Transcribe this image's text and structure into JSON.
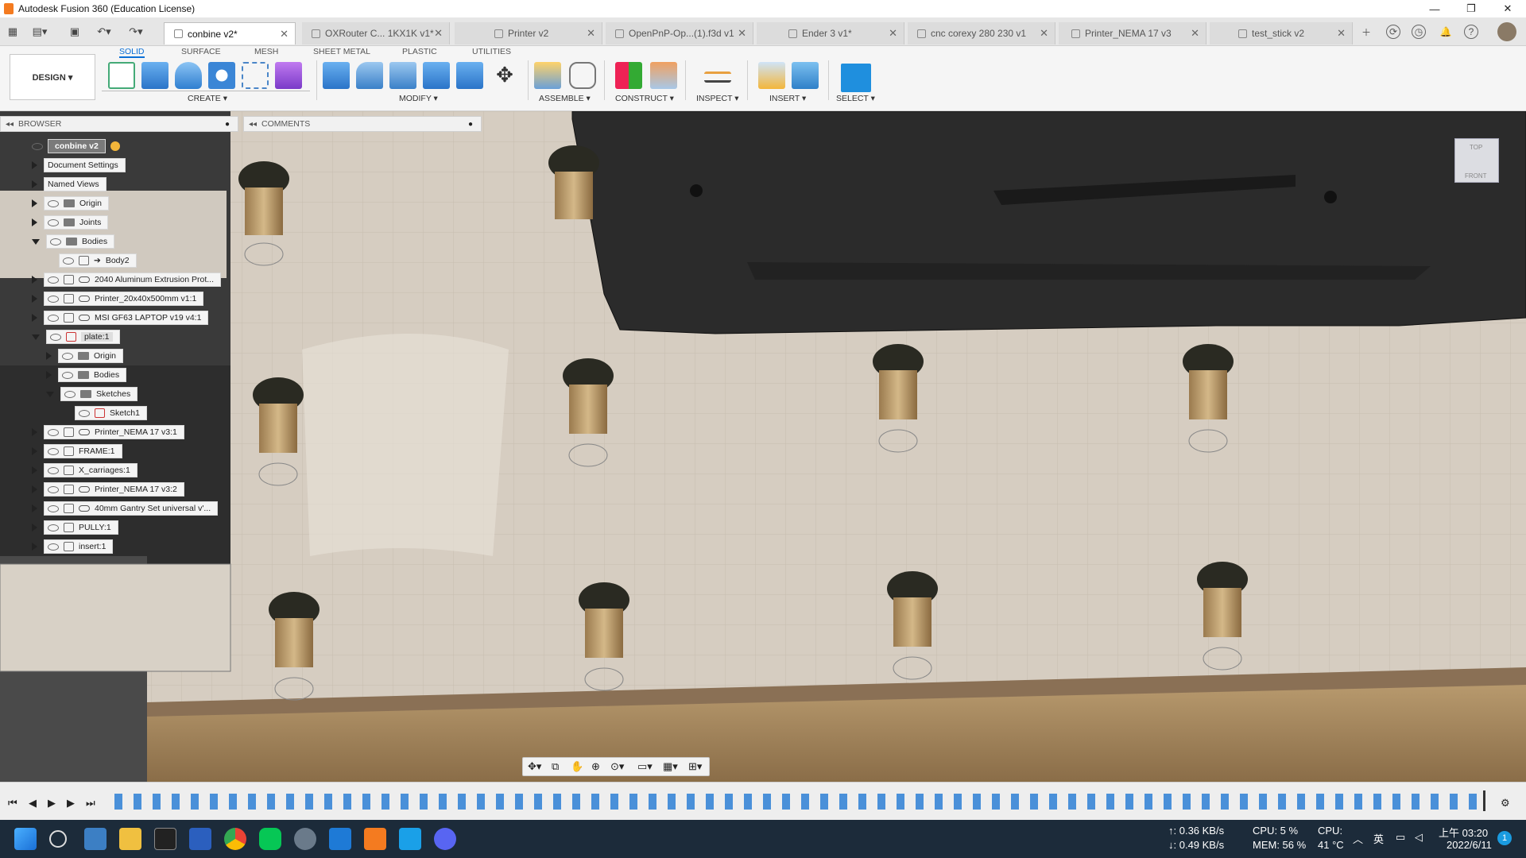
{
  "window": {
    "title": "Autodesk Fusion 360 (Education License)"
  },
  "tabs": [
    {
      "label": "conbine v2*",
      "active": true
    },
    {
      "label": "OXRouter C... 1KX1K v1*",
      "active": false
    },
    {
      "label": "Printer v2",
      "active": false
    },
    {
      "label": "OpenPnP-Op...(1).f3d v1",
      "active": false
    },
    {
      "label": "Ender 3 v1*",
      "active": false
    },
    {
      "label": "cnc corexy 280 230  v1",
      "active": false
    },
    {
      "label": "Printer_NEMA 17 v3",
      "active": false
    },
    {
      "label": "test_stick v2",
      "active": false
    }
  ],
  "toolbar": {
    "design_label": "DESIGN ▾",
    "workspace_tabs": [
      "SOLID",
      "SURFACE",
      "MESH",
      "SHEET METAL",
      "PLASTIC",
      "UTILITIES"
    ],
    "groups": [
      "CREATE ▾",
      "MODIFY ▾",
      "ASSEMBLE ▾",
      "CONSTRUCT ▾",
      "INSPECT ▾",
      "INSERT ▾",
      "SELECT ▾"
    ]
  },
  "panels": {
    "browser": "BROWSER",
    "comments": "COMMENTS"
  },
  "browser_tree": [
    "conbine v2",
    "Document Settings",
    "Named Views",
    "Origin",
    "Joints",
    "Bodies",
    "Body2",
    "2040 Aluminum Extrusion Prot...",
    "Printer_20x40x500mm v1:1",
    "MSI GF63 LAPTOP v19 v4:1",
    "plate:1",
    "Origin",
    "Bodies",
    "Sketches",
    "Sketch1",
    "Printer_NEMA 17 v3:1",
    "FRAME:1",
    "X_carriages:1",
    "Printer_NEMA 17 v3:2",
    "40mm Gantry Set universal v'...",
    "PULLY:1",
    "insert:1"
  ],
  "viewcube": {
    "top": "TOP",
    "front": "FRONT"
  },
  "taskbar": {
    "net_up": "↑: 0.36 KB/s",
    "net_down": "↓: 0.49 KB/s",
    "cpu": "CPU: 5 %",
    "mem": "MEM: 56 %",
    "cpu_temp_label": "CPU:",
    "cpu_temp": "41 °C",
    "ime": "英",
    "time": "上午 03:20",
    "date": "2022/6/11",
    "notif": "1"
  }
}
